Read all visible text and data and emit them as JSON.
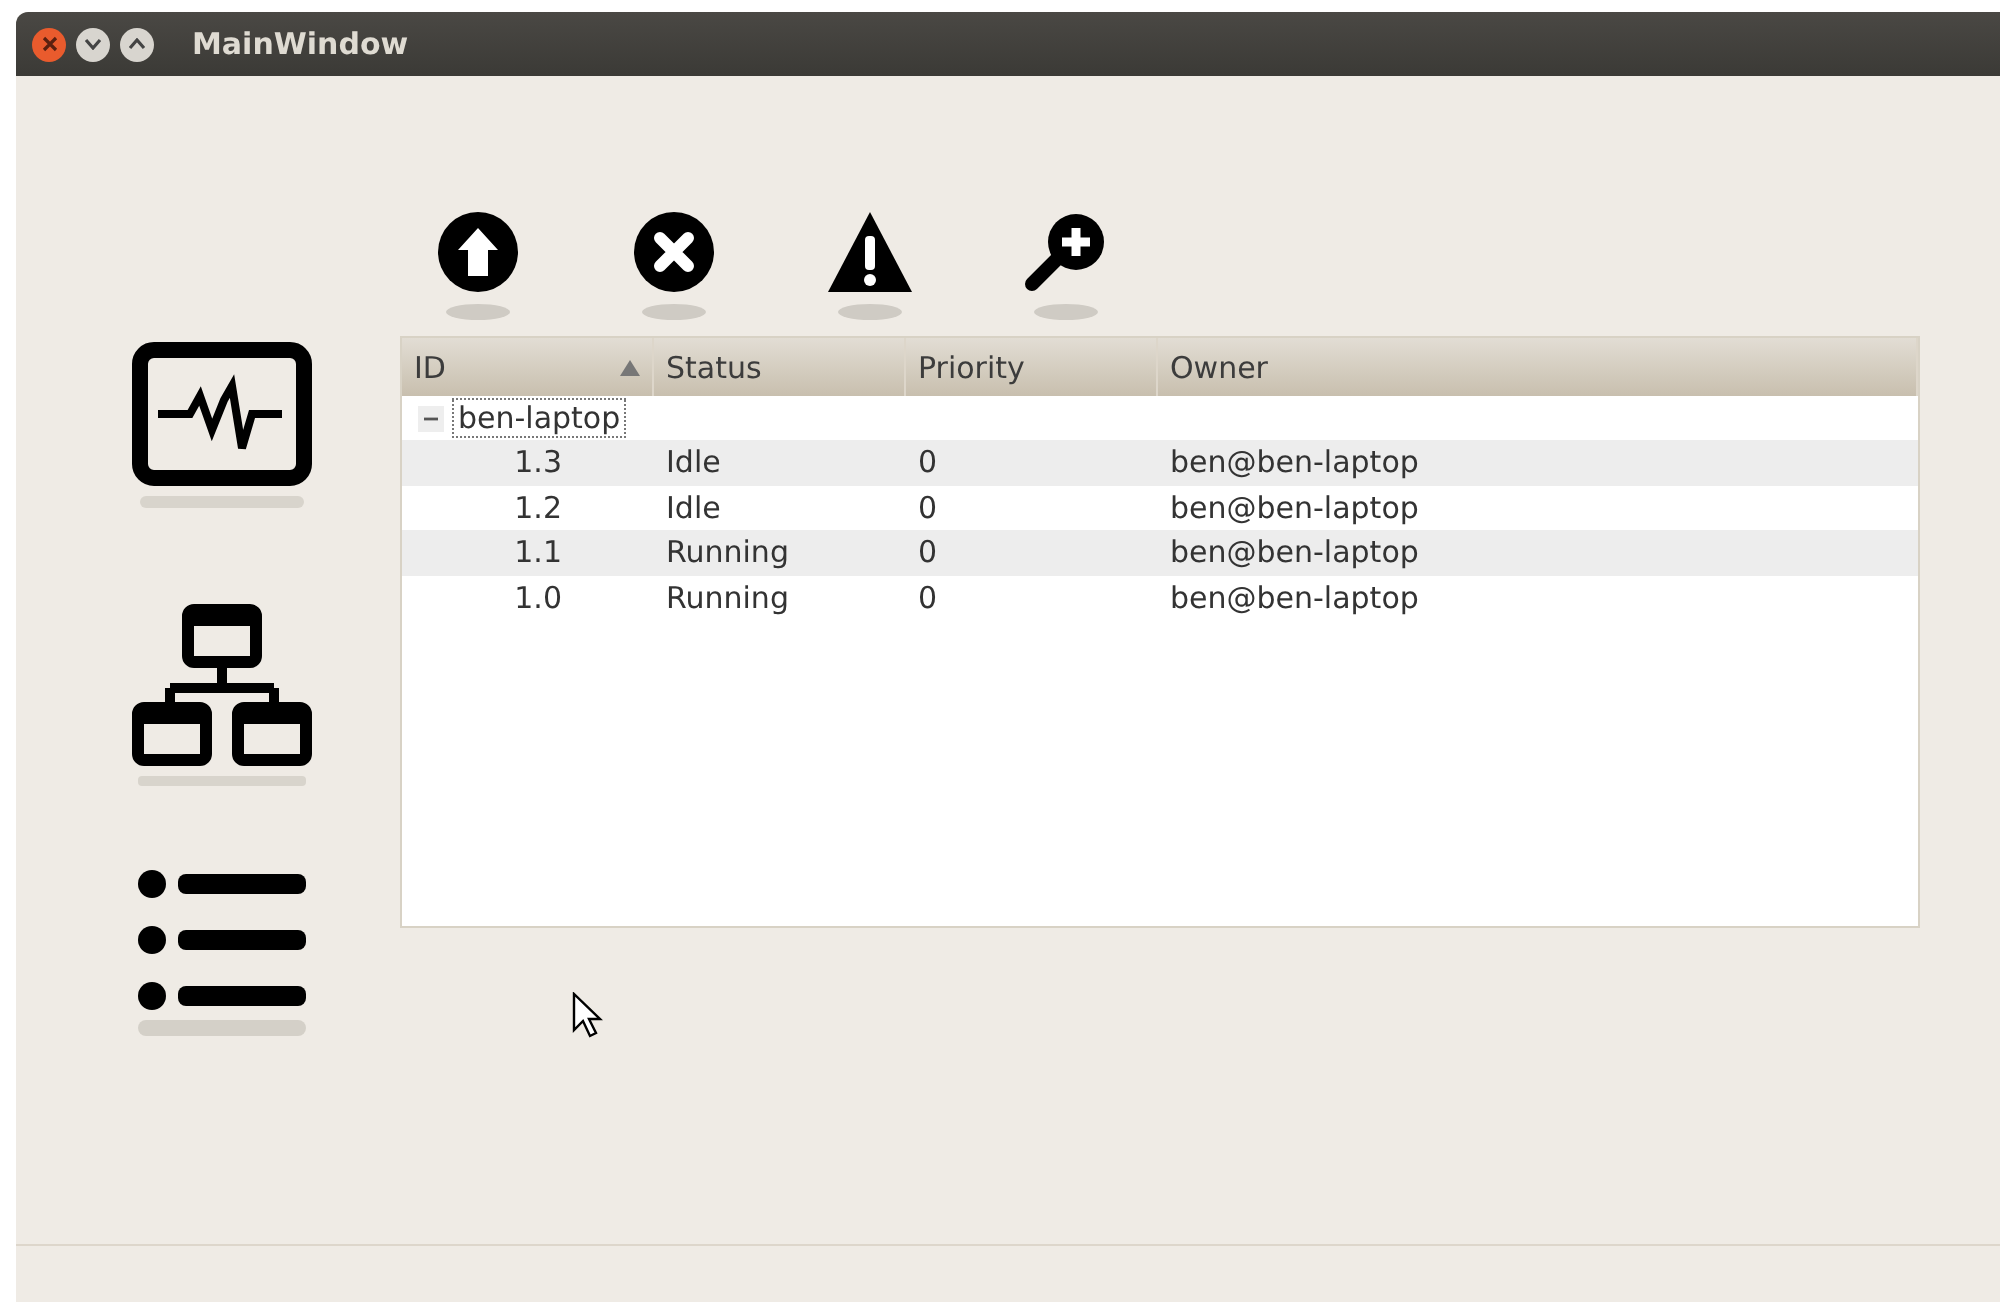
{
  "window": {
    "title": "MainWindow"
  },
  "toolbar": [
    {
      "kind": "up"
    },
    {
      "kind": "cancel"
    },
    {
      "kind": "warning"
    },
    {
      "kind": "zoom"
    }
  ],
  "sidebar": [
    {
      "kind": "monitor"
    },
    {
      "kind": "network"
    },
    {
      "kind": "list"
    }
  ],
  "table": {
    "columns": [
      {
        "label": "ID",
        "sorted": true
      },
      {
        "label": "Status",
        "sorted": false
      },
      {
        "label": "Priority",
        "sorted": false
      },
      {
        "label": "Owner",
        "sorted": false
      }
    ],
    "groups": [
      {
        "label": "ben-laptop",
        "expanded": true,
        "children": [
          {
            "cells": [
              "1.3",
              "Idle",
              "0",
              "ben@ben-laptop"
            ]
          },
          {
            "cells": [
              "1.2",
              "Idle",
              "0",
              "ben@ben-laptop"
            ]
          },
          {
            "cells": [
              "1.1",
              "Running",
              "0",
              "ben@ben-laptop"
            ]
          },
          {
            "cells": [
              "1.0",
              "Running",
              "0",
              "ben@ben-laptop"
            ]
          }
        ]
      }
    ]
  }
}
